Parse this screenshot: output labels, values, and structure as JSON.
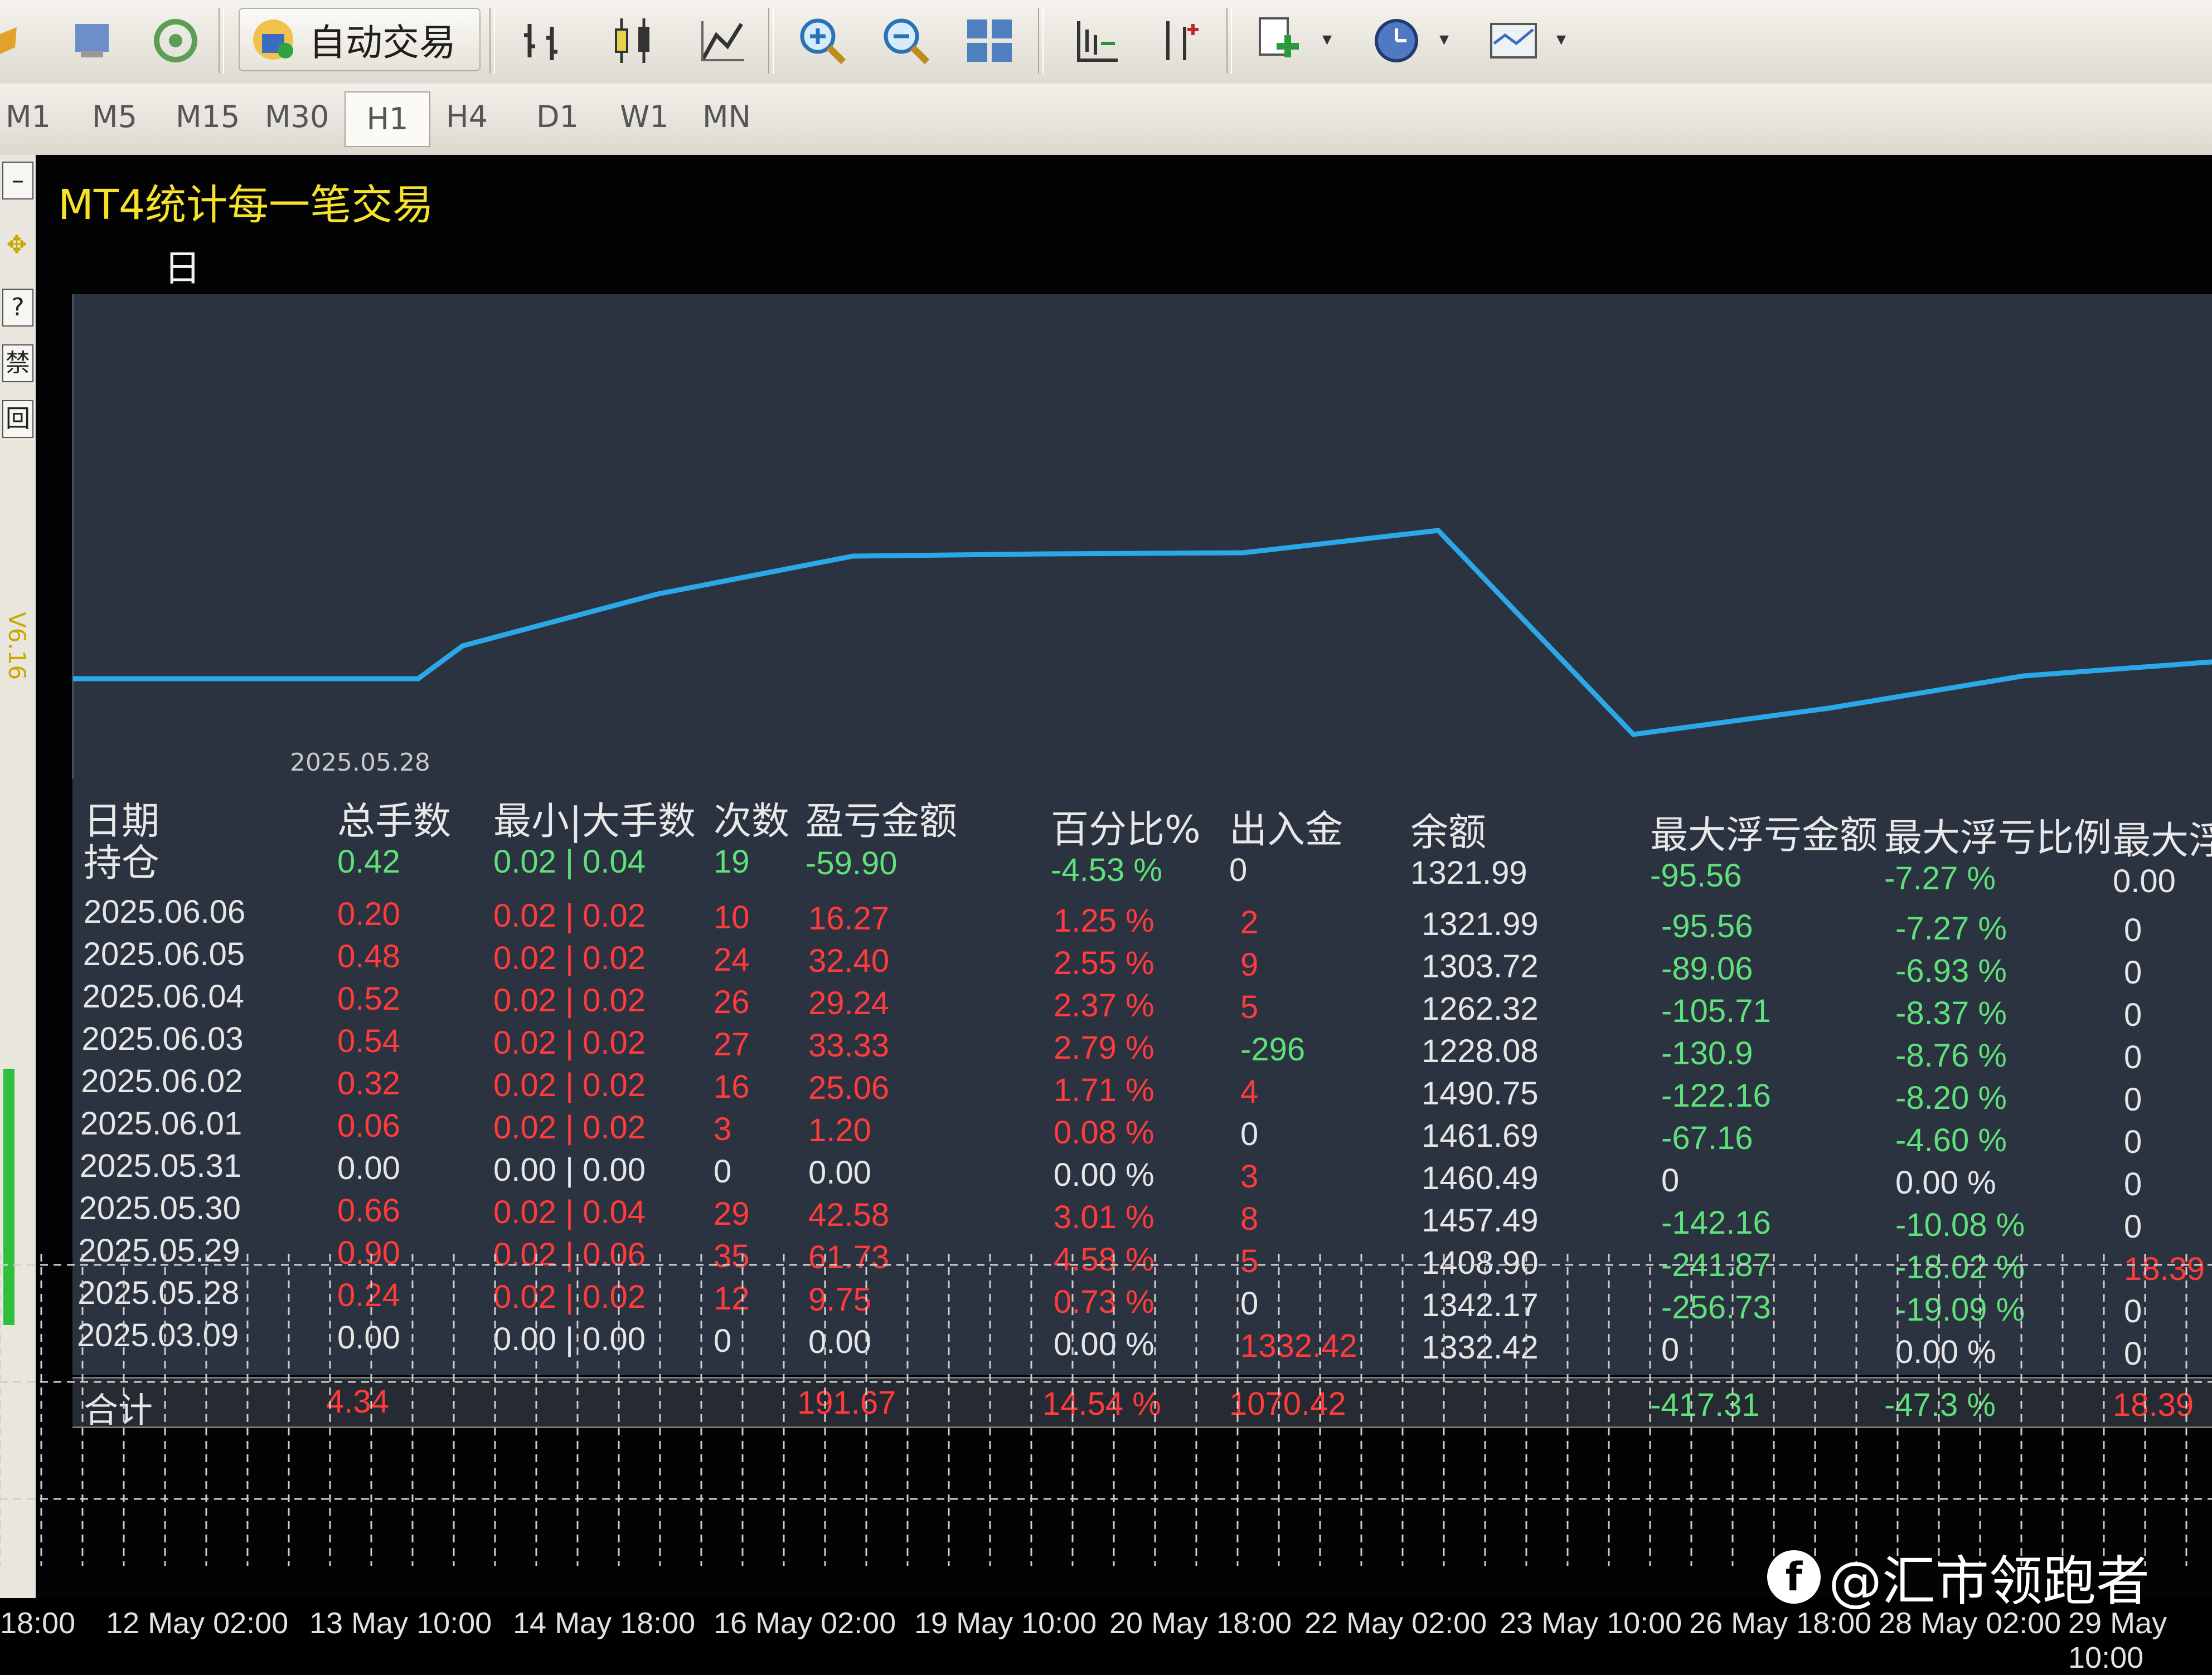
{
  "toolbar": {
    "auto_trade_label": "自动交易",
    "dropdown_glyph": "▾"
  },
  "timeframes": [
    "M1",
    "M5",
    "M15",
    "M30",
    "H1",
    "H4",
    "D1",
    "W1",
    "MN"
  ],
  "active_timeframe": "H1",
  "side": {
    "help": "?",
    "btn_a": "禁",
    "btn_b": "回",
    "version": "V6.16"
  },
  "indicator": {
    "title": "MT4统计每一笔交易",
    "active_tab": "日"
  },
  "equity_curve": {
    "start_date_label": "2025.05.28",
    "line_color": "#2aa8e8"
  },
  "table": {
    "headers": {
      "date": "日期",
      "holding": "持仓",
      "lots": "总手数",
      "minmax": "最小|大手数",
      "count": "次数",
      "pnl": "盈亏金额",
      "pct": "百分比%",
      "inout": "出入金",
      "balance": "余额",
      "max_float_loss": "最大浮亏金额",
      "max_float_loss_pct": "最大浮亏比例",
      "max_float_profit": "最大浮盈"
    },
    "holding_row": {
      "lots": "0.42",
      "minmax": "0.02 | 0.04",
      "count": "19",
      "pnl": "-59.90",
      "pct": "-4.53 %",
      "inout": "0",
      "balance": "1321.99",
      "mfl": "-95.56",
      "mflp": "-7.27 %",
      "mfp": "0.00"
    },
    "rows": [
      {
        "date": "2025.06.06",
        "lots": "0.20",
        "minmax": "0.02 | 0.02",
        "count": "10",
        "pnl": "16.27",
        "pct": "1.25 %",
        "inout": "2",
        "balance": "1321.99",
        "mfl": "-95.56",
        "mflp": "-7.27 %",
        "mfp": "0"
      },
      {
        "date": "2025.06.05",
        "lots": "0.48",
        "minmax": "0.02 | 0.02",
        "count": "24",
        "pnl": "32.40",
        "pct": "2.55 %",
        "inout": "9",
        "balance": "1303.72",
        "mfl": "-89.06",
        "mflp": "-6.93 %",
        "mfp": "0"
      },
      {
        "date": "2025.06.04",
        "lots": "0.52",
        "minmax": "0.02 | 0.02",
        "count": "26",
        "pnl": "29.24",
        "pct": "2.37 %",
        "inout": "5",
        "balance": "1262.32",
        "mfl": "-105.71",
        "mflp": "-8.37 %",
        "mfp": "0"
      },
      {
        "date": "2025.06.03",
        "lots": "0.54",
        "minmax": "0.02 | 0.02",
        "count": "27",
        "pnl": "33.33",
        "pct": "2.79 %",
        "inout": "-296",
        "balance": "1228.08",
        "mfl": "-130.9",
        "mflp": "-8.76 %",
        "mfp": "0"
      },
      {
        "date": "2025.06.02",
        "lots": "0.32",
        "minmax": "0.02 | 0.02",
        "count": "16",
        "pnl": "25.06",
        "pct": "1.71 %",
        "inout": "4",
        "balance": "1490.75",
        "mfl": "-122.16",
        "mflp": "-8.20 %",
        "mfp": "0"
      },
      {
        "date": "2025.06.01",
        "lots": "0.06",
        "minmax": "0.02 | 0.02",
        "count": "3",
        "pnl": "1.20",
        "pct": "0.08 %",
        "inout": "0",
        "balance": "1461.69",
        "mfl": "-67.16",
        "mflp": "-4.60 %",
        "mfp": "0"
      },
      {
        "date": "2025.05.31",
        "lots": "0.00",
        "minmax": "0.00 | 0.00",
        "count": "0",
        "pnl": "0.00",
        "pct": "0.00 %",
        "inout": "3",
        "balance": "1460.49",
        "mfl": "0",
        "mflp": "0.00 %",
        "mfp": "0"
      },
      {
        "date": "2025.05.30",
        "lots": "0.66",
        "minmax": "0.02 | 0.04",
        "count": "29",
        "pnl": "42.58",
        "pct": "3.01 %",
        "inout": "8",
        "balance": "1457.49",
        "mfl": "-142.16",
        "mflp": "-10.08 %",
        "mfp": "0"
      },
      {
        "date": "2025.05.29",
        "lots": "0.90",
        "minmax": "0.02 | 0.06",
        "count": "35",
        "pnl": "61.73",
        "pct": "4.58 %",
        "inout": "5",
        "balance": "1408.90",
        "mfl": "-241.87",
        "mflp": "-18.02 %",
        "mfp": "18.39"
      },
      {
        "date": "2025.05.28",
        "lots": "0.24",
        "minmax": "0.02 | 0.02",
        "count": "12",
        "pnl": "9.75",
        "pct": "0.73 %",
        "inout": "0",
        "balance": "1342.17",
        "mfl": "-256.73",
        "mflp": "-19.09 %",
        "mfp": "0"
      },
      {
        "date": "2025.03.09",
        "lots": "0.00",
        "minmax": "0.00 | 0.00",
        "count": "0",
        "pnl": "0.00",
        "pct": "0.00 %",
        "inout": "1332.42",
        "balance": "1332.42",
        "mfl": "0",
        "mflp": "0.00 %",
        "mfp": "0"
      }
    ],
    "total_row": {
      "label": "合计",
      "lots": "4.34",
      "pnl": "191.67",
      "pct": "14.54 %",
      "inout": "1070.42",
      "mfl": "-417.31",
      "mflp": "-47.3 %",
      "mfp": "18.39"
    }
  },
  "xaxis_labels": [
    "18:00",
    "12 May 02:00",
    "13 May 10:00",
    "14 May 18:00",
    "16 May 02:00",
    "19 May 10:00",
    "20 May 18:00",
    "22 May 02:00",
    "23 May 10:00",
    "26 May 18:00",
    "28 May 02:00",
    "29 May 10:00"
  ],
  "watermark": {
    "logo": "f",
    "text": "@汇市领跑者"
  }
}
